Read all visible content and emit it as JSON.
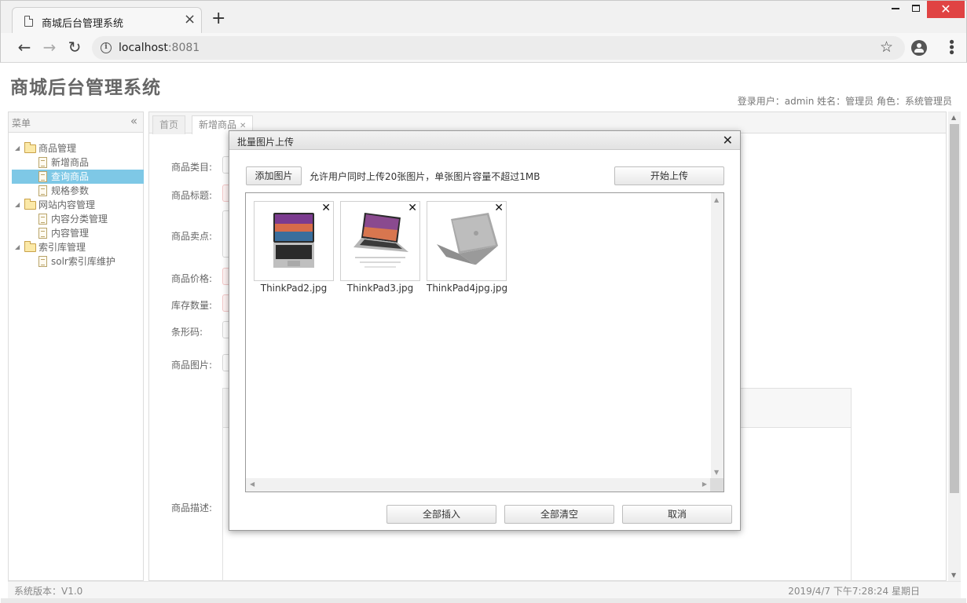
{
  "browser": {
    "tab_title": "商城后台管理系统",
    "url_host": "localhost",
    "url_port": ":8081"
  },
  "app": {
    "title": "商城后台管理系统",
    "user_info": "登录用户：admin  姓名：管理员  角色：系统管理员"
  },
  "menu": {
    "header": "菜单",
    "groups": [
      {
        "label": "商品管理",
        "items": [
          "新增商品",
          "查询商品",
          "规格参数"
        ],
        "selected_index": 1
      },
      {
        "label": "网站内容管理",
        "items": [
          "内容分类管理",
          "内容管理"
        ]
      },
      {
        "label": "索引库管理",
        "items": [
          "solr索引库维护"
        ]
      }
    ]
  },
  "content_tabs": {
    "home": "首页",
    "active": "新增商品"
  },
  "form": {
    "labels": [
      "商品类目:",
      "商品标题:",
      "商品卖点:",
      "商品价格:",
      "库存数量:",
      "条形码:",
      "商品图片:",
      "商品描述:"
    ]
  },
  "dialog": {
    "title": "批量图片上传",
    "add_button": "添加图片",
    "hint": "允许用户同时上传20张图片，单张图片容量不超过1MB",
    "start_button": "开始上传",
    "images": [
      {
        "name": "ThinkPad2.jpg"
      },
      {
        "name": "ThinkPad3.jpg"
      },
      {
        "name": "ThinkPad4jpg.jpg"
      }
    ],
    "insert_all": "全部插入",
    "clear_all": "全部清空",
    "cancel": "取消"
  },
  "status": {
    "version": "系统版本：V1.0",
    "datetime": "2019/4/7 下午7:28:24 星期日"
  }
}
